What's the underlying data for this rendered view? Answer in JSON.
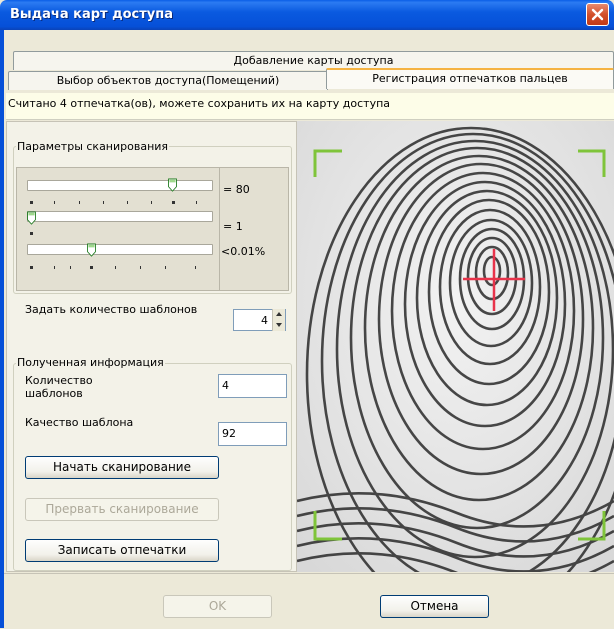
{
  "window": {
    "title": "Выдача карт доступа"
  },
  "tabs": {
    "row1": [
      "Добавление карты доступа"
    ],
    "row2": [
      "Выбор объектов доступа(Помещений)",
      "Регистрация отпечатков пальцев"
    ],
    "active": "Регистрация отпечатков пальцев"
  },
  "info": {
    "message": "Считано 4 отпечатка(ов), можете сохранить их на карту доступа"
  },
  "scan_params": {
    "title": "Параметры сканирования",
    "sliders": [
      {
        "value_label": "= 80",
        "position_fraction": 0.8
      },
      {
        "value_label": "= 1",
        "position_fraction": 0.0
      },
      {
        "value_label": "<0.01%",
        "position_fraction": 0.35
      }
    ]
  },
  "templates": {
    "label": "Задать количество шаблонов",
    "value": "4"
  },
  "received": {
    "title": "Полученная информация",
    "count_label": "Количество шаблонов",
    "count_value": "4",
    "quality_label": "Качество шаблона",
    "quality_value": "92"
  },
  "buttons": {
    "start_scan": "Начать сканирование",
    "stop_scan": "Прервать сканирование",
    "write_prints": "Записать отпечатки",
    "ok": "OK",
    "cancel": "Отмена"
  },
  "colors": {
    "title_bar": "#0a5ae0",
    "corner_marks": "#7fc43a",
    "crosshair": "#e8334a",
    "info_bg": "#fdfde8"
  },
  "icons": {
    "close": "close-icon"
  }
}
